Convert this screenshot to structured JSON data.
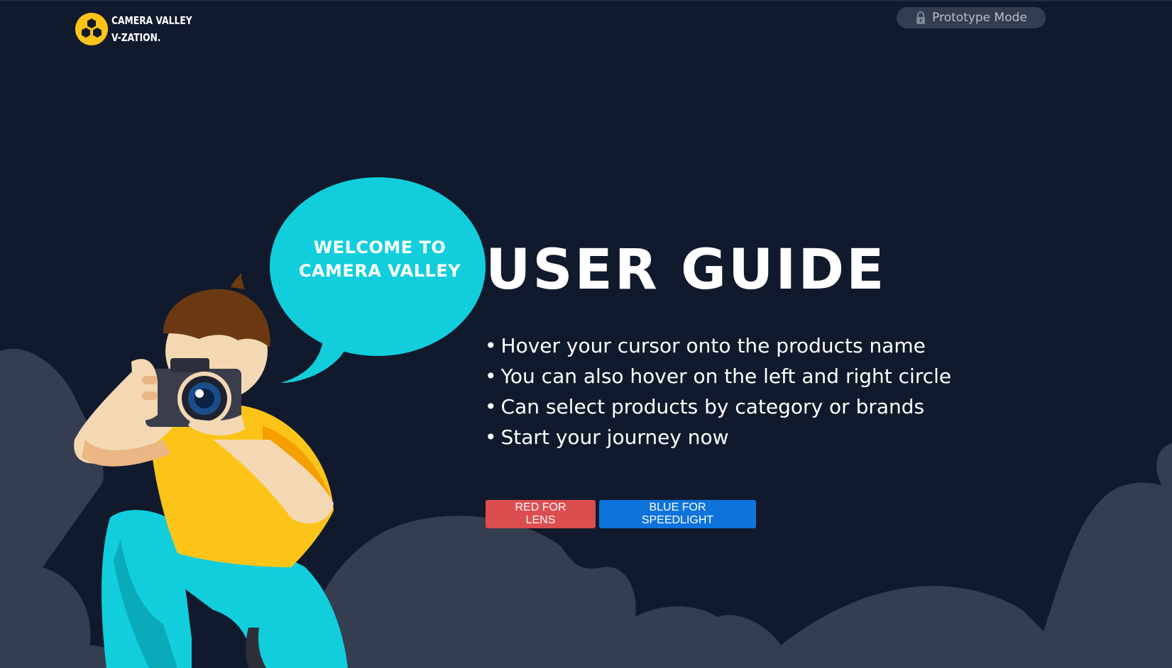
{
  "header": {
    "logo_line1": "CAMERA VALLEY",
    "logo_line2": "V-ZATION.",
    "logo_icon": "hexagon-cluster-icon",
    "prototype_label": "Prototype Mode",
    "prototype_icon": "lock-icon"
  },
  "hero": {
    "bubble_line1": "WELCOME TO",
    "bubble_line2": "CAMERA VALLEY",
    "title": "USER GUIDE",
    "bullets": [
      "Hover your cursor onto the products name",
      "You can also hover on the left and right circle",
      "Can select products by category or brands",
      "Start your journey now"
    ],
    "bullet_char": "•",
    "buttons": {
      "red_label": "RED FOR LENS",
      "blue_label": "BLUE FOR SPEEDLIGHT"
    }
  },
  "colors": {
    "background": "#111a2c",
    "cloud": "#343e50",
    "bubble": "#12cedc",
    "red_button": "#dc4d4f",
    "blue_button": "#0f73dc",
    "logo_yellow": "#fcc419"
  }
}
